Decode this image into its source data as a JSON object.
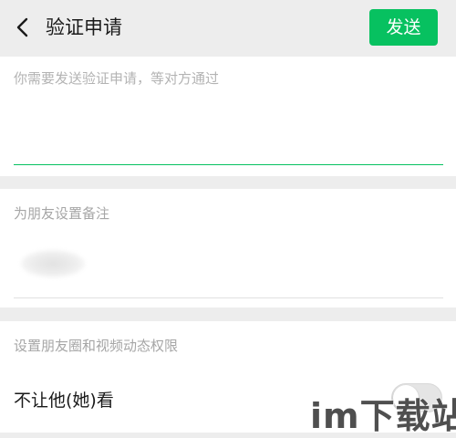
{
  "header": {
    "title": "验证申请",
    "back_icon": "chevron-left-icon",
    "send_label": "发送",
    "send_color": "#07c160"
  },
  "verify": {
    "placeholder": "你需要发送验证申请，等对方通过",
    "value": ""
  },
  "remark": {
    "label": "为朋友设置备注"
  },
  "permissions": {
    "label": "设置朋友圈和视频动态权限",
    "block_label": "不让他(她)看",
    "block_enabled": false
  },
  "watermark": "im下载站"
}
